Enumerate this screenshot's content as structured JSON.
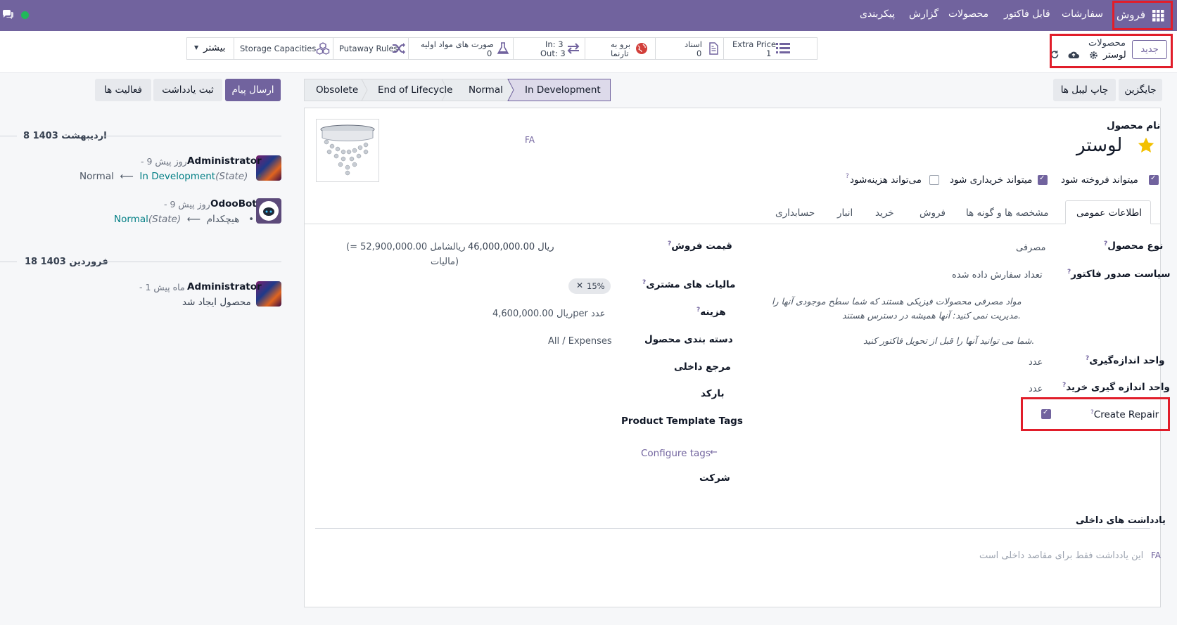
{
  "topbar": {
    "app_name": "فروش",
    "menu": [
      "سفارشات",
      "قابل فاکتور",
      "محصولات",
      "گزارش",
      "پیکربندی"
    ]
  },
  "control": {
    "new_label": "جدید",
    "breadcrumb_parent": "محصولات",
    "breadcrumb_current": "لوستر",
    "smart_buttons": {
      "extra_price_label": "Extra Price",
      "extra_price_value": "1",
      "docs_label": "اسناد",
      "docs_value": "0",
      "website_label1": "برو به",
      "website_label2": "تارنما",
      "in_label": "In: 3",
      "out_label": "Out: 3",
      "bom_label": "صورت های مواد اولیه",
      "bom_value": "0",
      "putaway": "Putaway Rules",
      "storage": "Storage Capacities",
      "more": "بیشتر"
    }
  },
  "actions": {
    "replace": "جایگزین",
    "print_labels": "چاپ لیبل ها",
    "send_message": "ارسال پیام",
    "log_note": "ثبت یادداشت",
    "activities": "فعالیت ها"
  },
  "status": {
    "stages": [
      "In Development",
      "Normal",
      "End of Lifecycle",
      "Obsolete"
    ],
    "active": "In Development"
  },
  "form": {
    "name_label": "نام محصول",
    "name": "لوستر",
    "lang": "FA",
    "can_be_sold": "میتواند فروخته شود",
    "can_be_purchased": "میتواند خریداری شود",
    "can_be_expensed": "می‌تواند هزینه‌شود",
    "tabs": [
      "اطلاعات عمومی",
      "مشخصه ها و گونه ها",
      "فروش",
      "خرید",
      "انبار",
      "حسابداری"
    ],
    "active_tab": "اطلاعات عمومی",
    "product_type_label": "نوع محصول",
    "product_type": "مصرفی",
    "invoice_policy_label": "سیاست صدور فاکتور",
    "invoice_policy": "تعداد سفارش داده شده",
    "consumable_help_1": "مواد مصرفی محصولات فیزیکی هستند که شما سطح موجودی آنها را",
    "consumable_help_2": "مدیریت نمی کنید: آنها همیشه در دسترس هستند.",
    "invoice_help": "شما می توانید آنها را قبل از تحویل فاکتور کنید.",
    "uom_label": "واحد اندازه‌گیری",
    "uom": "عدد",
    "purchase_uom_label": "واحد اندازه گیری خرید",
    "purchase_uom": "عدد",
    "create_repair_label": "Create Repair",
    "sales_price_label": "قیمت فروش",
    "sales_price": "46,000,000.00 ریال",
    "sales_price_tax_1": "(= 52,900,000.00 ریالشامل",
    "sales_price_tax_2": "مالیات)",
    "customer_taxes_label": "مالیات های مشتری",
    "customer_tax_tag": "15%",
    "cost_label": "هزینه",
    "cost": "4,600,000.00 ریالper عدد",
    "category_label": "دسته بندی محصول",
    "category": "All / Expenses",
    "internal_ref_label": "مرجع داخلی",
    "barcode_label": "بارکد",
    "tags_label": "Product Template Tags",
    "configure_tags": "Configure tags",
    "company_label": "شرکت",
    "internal_notes_label": "یادداشت های داخلی",
    "internal_notes_placeholder": "این یادداشت فقط برای مقاصد داخلی است",
    "notes_lang": "FA"
  },
  "chatter": {
    "groups": [
      {
        "date": "8 اردیبهشت 1403",
        "messages": [
          {
            "author": "Administrator",
            "ago": "- 9 روز پیش",
            "old": "Normal",
            "new": "In Development",
            "field": "(State)"
          },
          {
            "author": "OdooBot",
            "ago": "- 9 روز پیش",
            "old": "هیچکدام",
            "new": "Normal",
            "field": "(State)"
          }
        ]
      },
      {
        "date": "18 فروردین 1403",
        "messages": [
          {
            "author": "Administrator",
            "ago": "- 1 ماه پیش",
            "body": "محصول ایجاد شد"
          }
        ]
      }
    ]
  },
  "colors": {
    "brand": "#71639e",
    "highlight": "#e11d2a",
    "link": "#017e84",
    "star": "#f3c000"
  }
}
